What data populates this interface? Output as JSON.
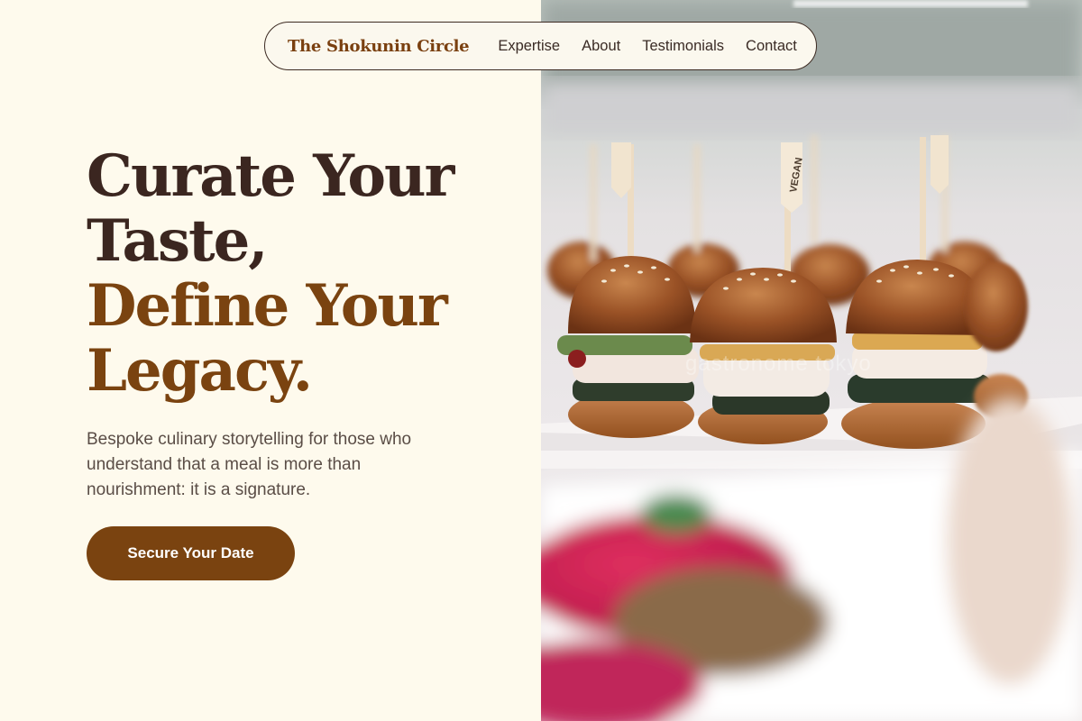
{
  "nav": {
    "brand": "The Shokunin Circle",
    "links": [
      "Expertise",
      "About",
      "Testimonials",
      "Contact"
    ]
  },
  "hero": {
    "headline_line1": "Curate Your",
    "headline_line2": "Taste,",
    "headline_line3": "Define Your",
    "headline_line4": "Legacy.",
    "subtitle": "Bespoke culinary storytelling for those who understand that a meal is more than nourishment: it is a signature.",
    "cta_label": "Secure Your Date"
  },
  "photo": {
    "pick_label": "VEGAN",
    "watermark": "gastronome tokyo"
  },
  "colors": {
    "background": "#fefaed",
    "accent": "#7a4310",
    "heading_dark": "#3b2620"
  }
}
